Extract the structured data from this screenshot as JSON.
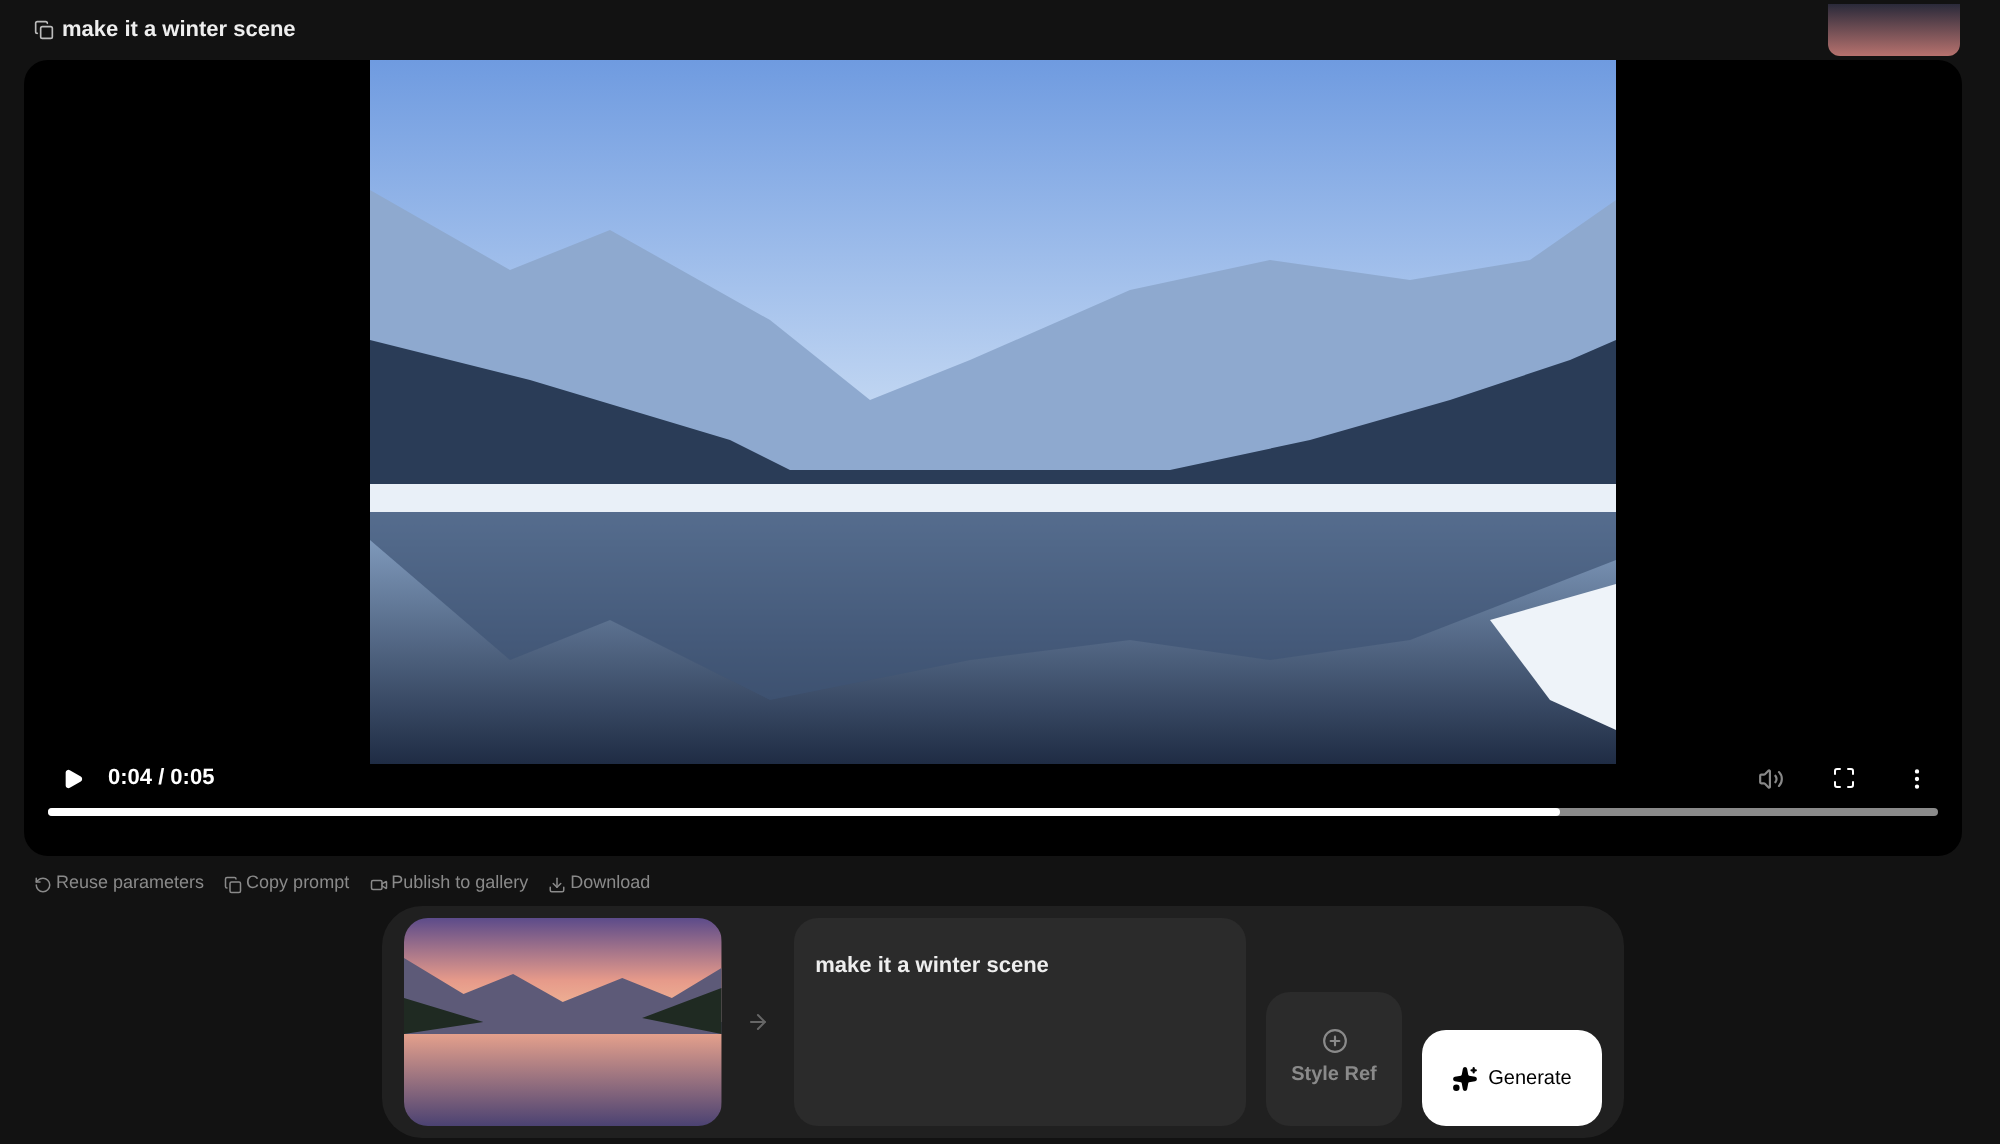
{
  "header": {
    "title": "make it a winter scene"
  },
  "video": {
    "time": "0:04 / 0:05",
    "level": 0.8,
    "playing": false
  },
  "actions": [
    {
      "label": "Reuse parameters",
      "kind": "reuse"
    },
    {
      "label": "Copy prompt",
      "kind": "copy"
    },
    {
      "label": "Publish to gallery",
      "kind": "publish"
    },
    {
      "label": "Download",
      "kind": "download"
    }
  ],
  "composer": {
    "prompt": "make it a winter scene",
    "style_ref": "Style Ref",
    "generate": "Generate"
  }
}
